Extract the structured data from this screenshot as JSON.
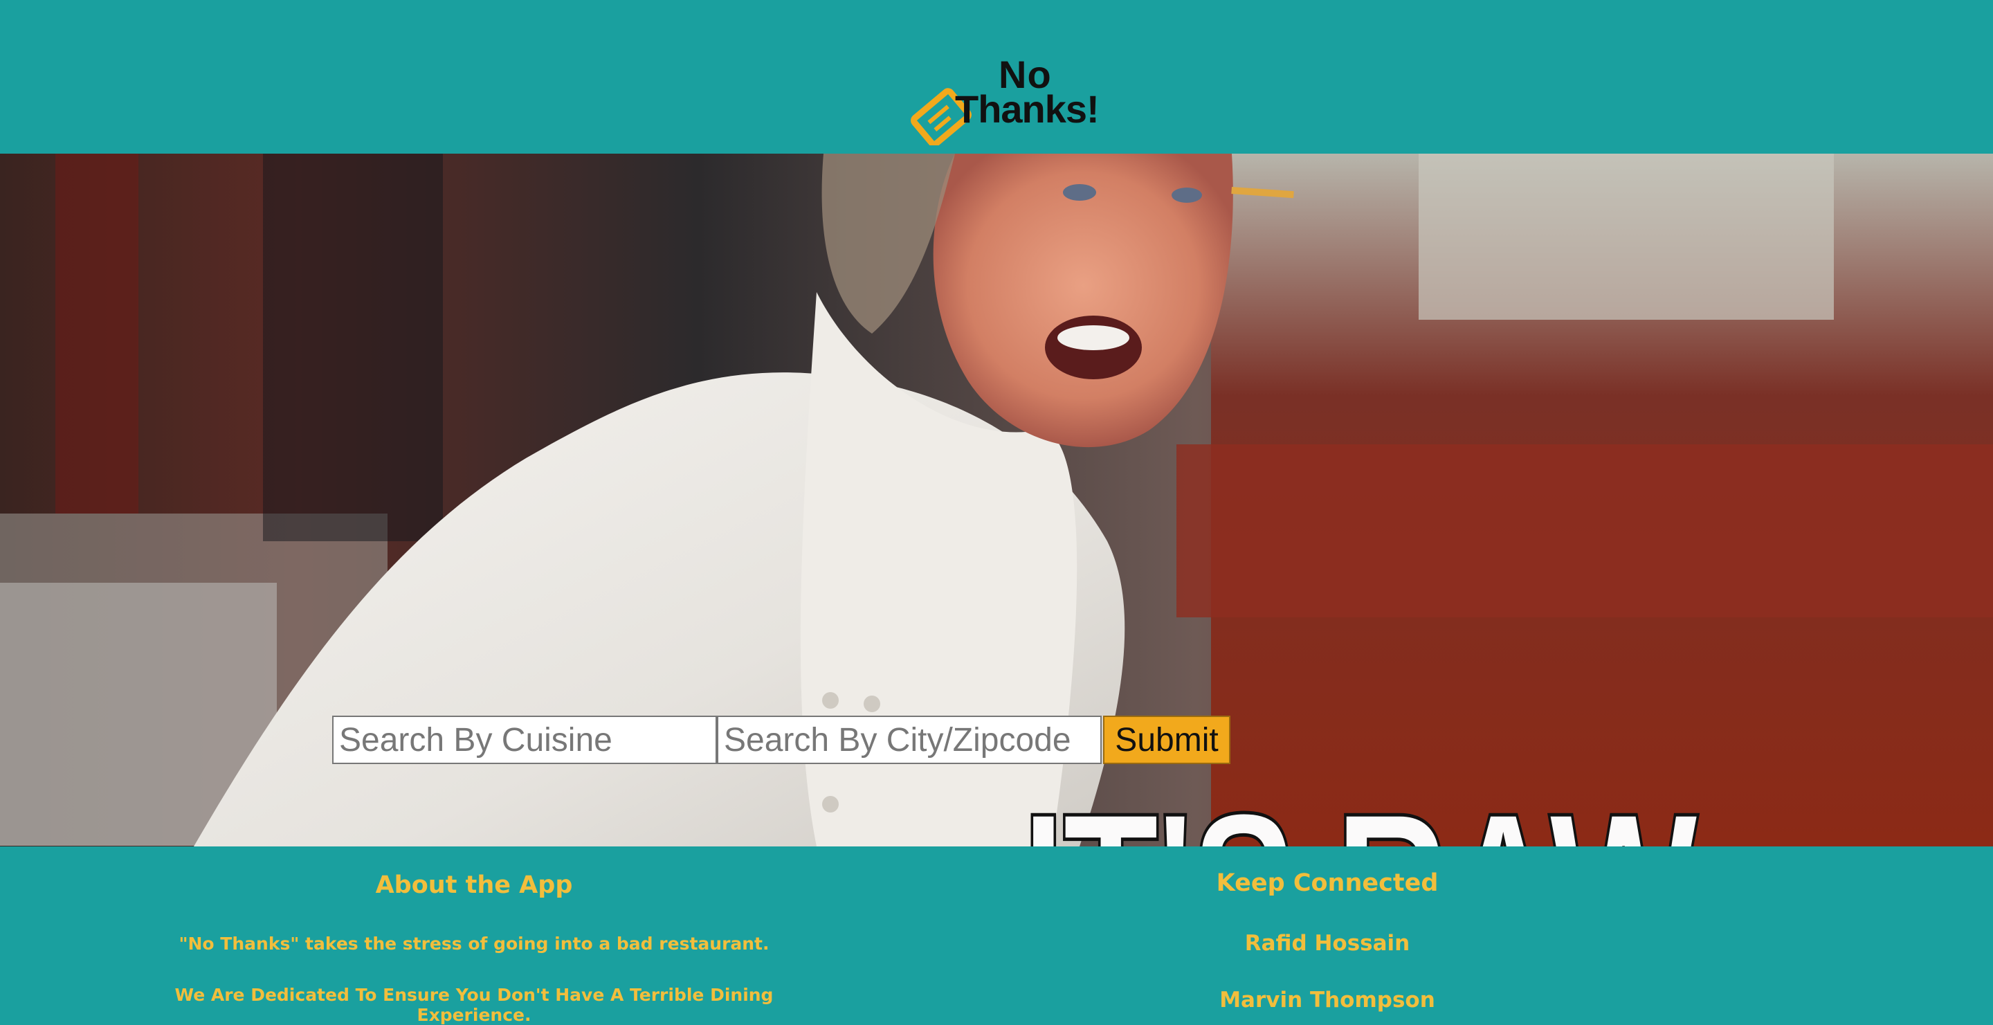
{
  "header": {
    "logo": {
      "line1": "No",
      "line2": "Thanks!",
      "icon": "price-tag-icon"
    }
  },
  "hero": {
    "image": "chef-shouting-photo",
    "caption": "IT'S RAW",
    "search": {
      "cuisine_placeholder": "Search By Cuisine",
      "location_placeholder": "Search By City/Zipcode",
      "submit_label": "Submit"
    }
  },
  "footer": {
    "about": {
      "title": "About the App",
      "line1": "\"No Thanks\" takes the stress of going into a bad restaurant.",
      "line2": "We Are Dedicated To Ensure You Don't Have A Terrible Dining Experience."
    },
    "connect": {
      "title": "Keep Connected",
      "people": [
        "Rafid Hossain",
        "Marvin Thompson"
      ]
    }
  },
  "colors": {
    "teal": "#1aa09f",
    "accent_orange": "#f2a91c",
    "footer_text": "#f2be3c"
  }
}
